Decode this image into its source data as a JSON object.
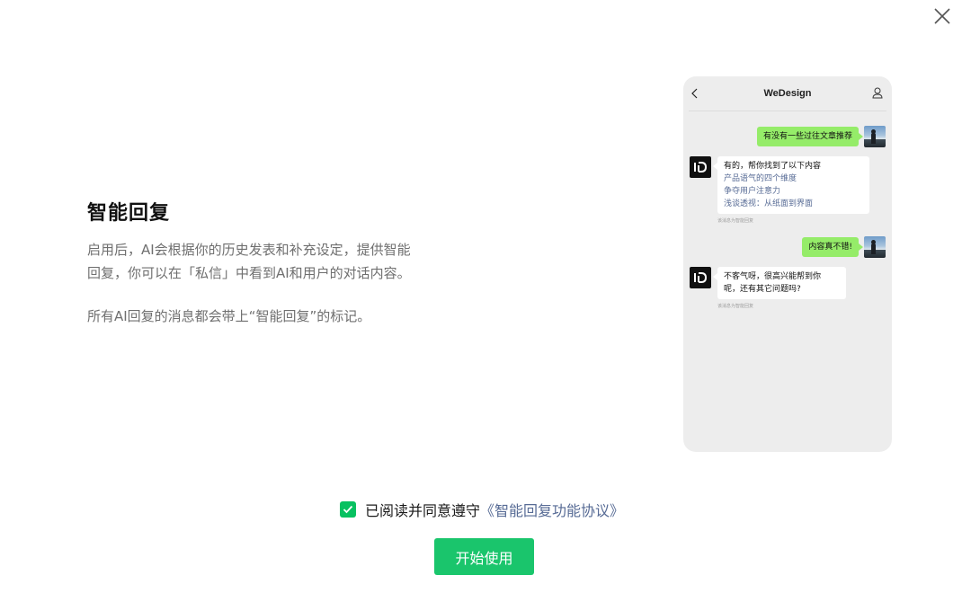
{
  "dialog": {
    "close_icon": "close-icon"
  },
  "intro": {
    "title": "智能回复",
    "description_line1": "启用后，AI会根据你的历史发表和补充设定，提供智能",
    "description_line2": "回复，你可以在「私信」中看到AI和用户的对话内容。",
    "mark_note": "所有AI回复的消息都会带上“智能回复”的标记。"
  },
  "preview": {
    "header_title": "WeDesign",
    "back_icon": "chevron-left-icon",
    "profile_icon": "user-icon",
    "messages": [
      {
        "from": "user",
        "text": "有没有一些过往文章推荐"
      },
      {
        "from": "ai",
        "lines": [
          "有的，帮你找到了以下内容"
        ],
        "links": [
          "产品语气的四个维度",
          "争夺用户注意力",
          "浅谈透视：从纸面到界面"
        ],
        "note": "该消息为智能回复"
      },
      {
        "from": "user",
        "text": "内容真不错!"
      },
      {
        "from": "ai",
        "lines": [
          "不客气呀，很高兴能帮到你",
          "呢，还有其它问题吗?"
        ],
        "note": "该消息为智能回复"
      }
    ]
  },
  "agreement": {
    "checked": true,
    "text": "已阅读并同意遵守",
    "link_text": "《智能回复功能协议》"
  },
  "start_button": {
    "label": "开始使用"
  },
  "colors": {
    "brand_green": "#07c160",
    "bubble_green": "#95ec69",
    "link_blue": "#576b95"
  }
}
